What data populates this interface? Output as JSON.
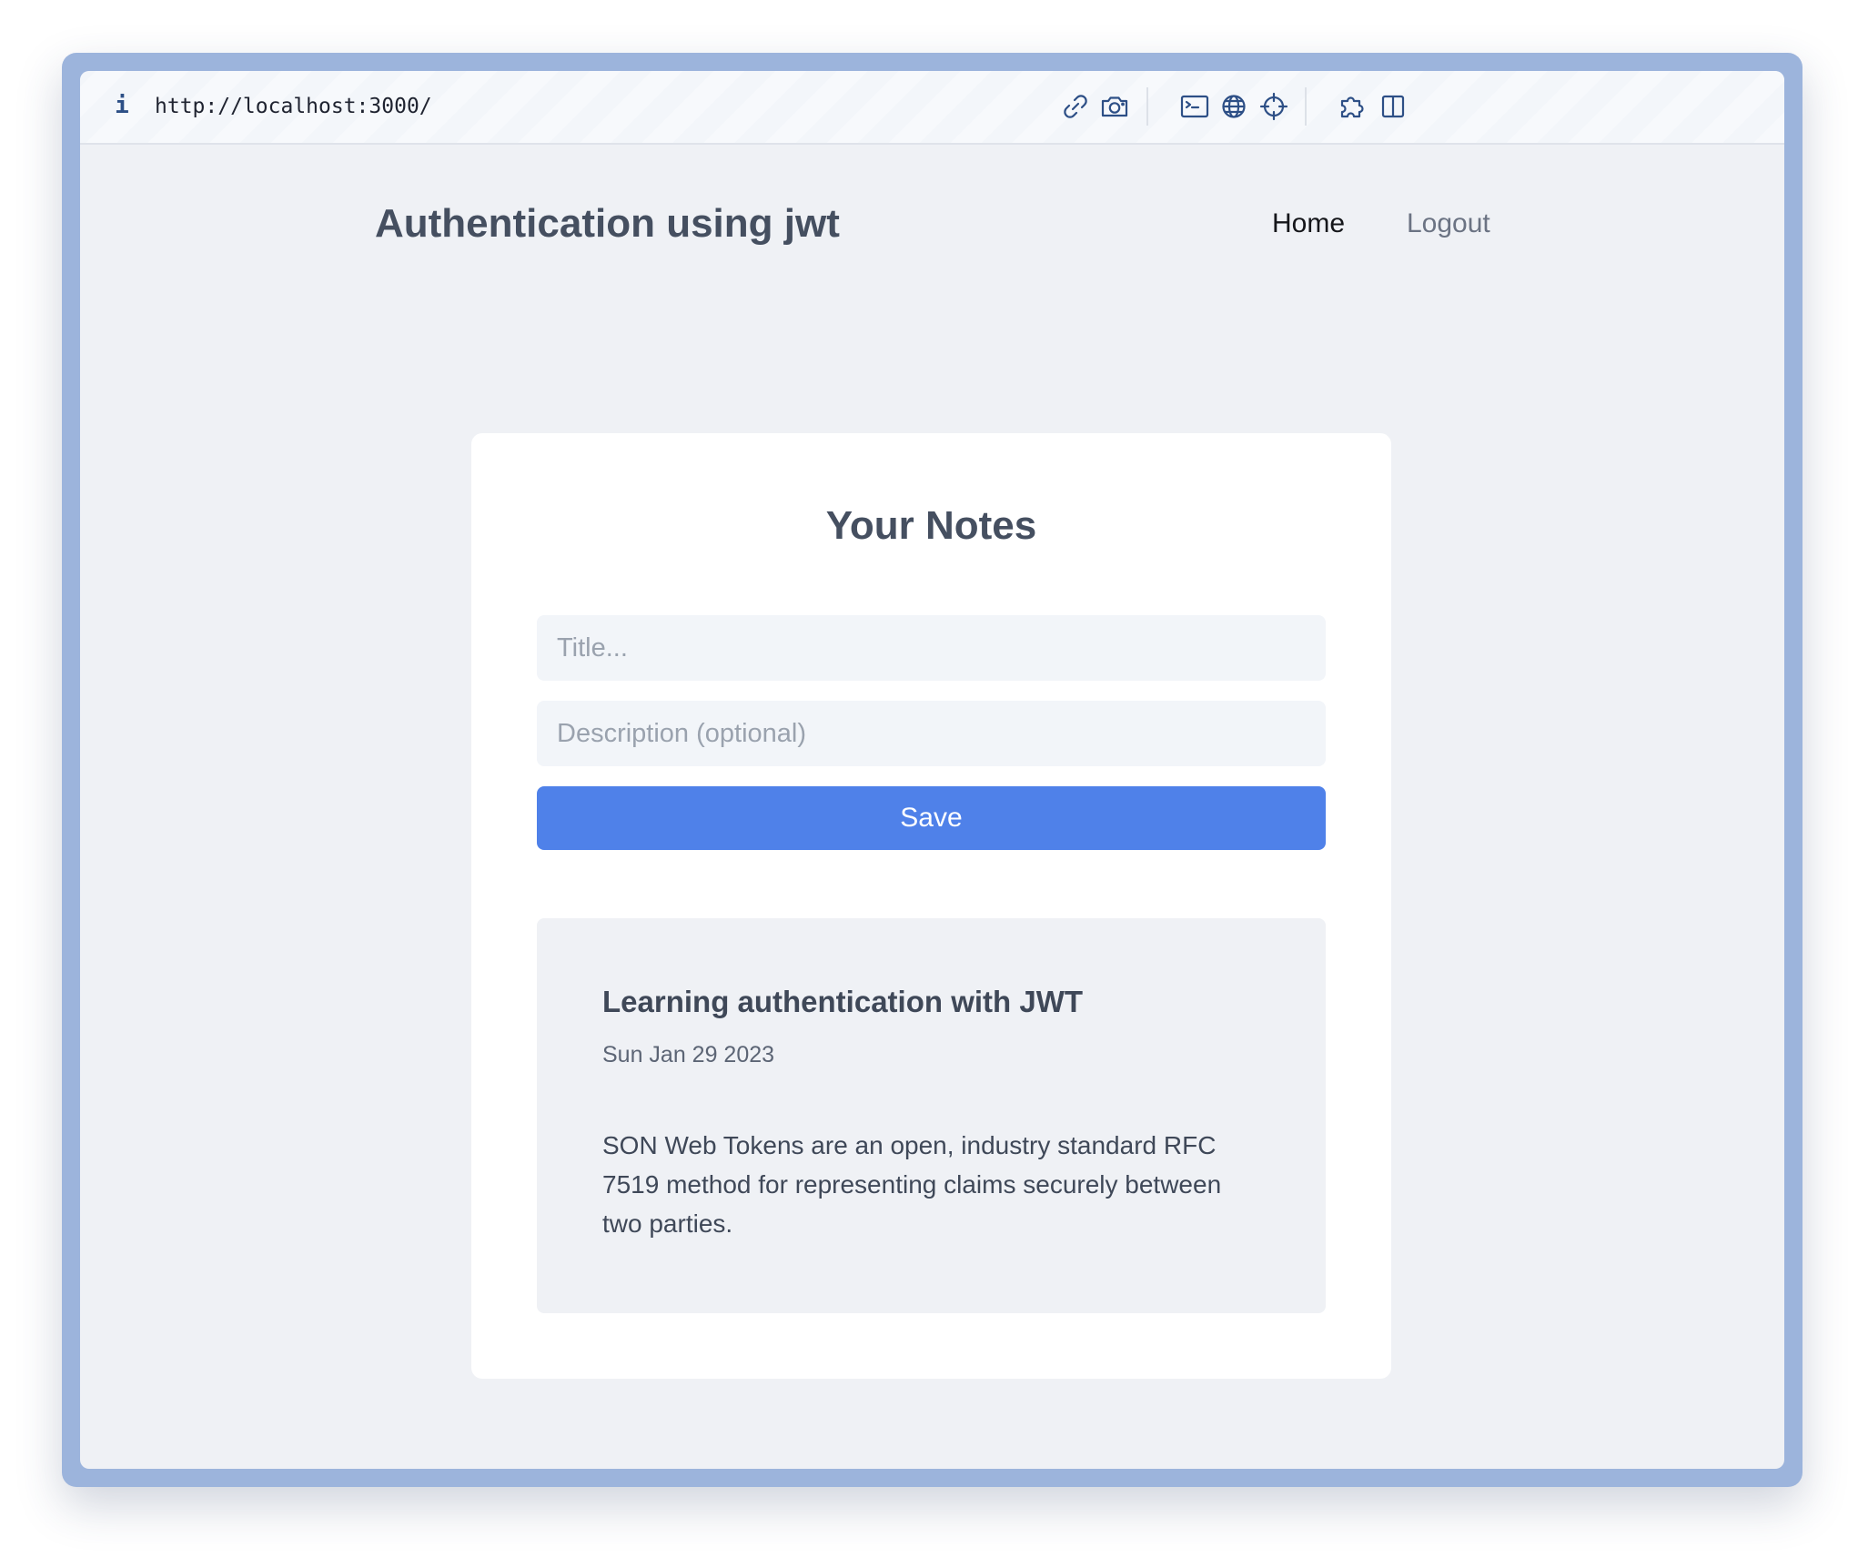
{
  "browser": {
    "info_icon": "i",
    "url": "http://localhost:3000/",
    "toolbar_icons": [
      "link-icon",
      "camera-icon",
      "terminal-icon",
      "globe-icon",
      "crosshair-icon",
      "puzzle-icon",
      "split-view-icon"
    ]
  },
  "header": {
    "title": "Authentication using jwt",
    "nav": {
      "home": "Home",
      "logout": "Logout"
    }
  },
  "notes_card": {
    "heading": "Your Notes",
    "title_placeholder": "Title...",
    "description_placeholder": "Description (optional)",
    "save_label": "Save"
  },
  "notes": [
    {
      "title": "Learning authentication with JWT",
      "date": "Sun Jan 29 2023",
      "body": "SON Web Tokens are an open, industry standard RFC 7519 method for representing claims securely between two parties."
    }
  ],
  "colors": {
    "accent": "#4f81e9",
    "frame": "#9cb4dc",
    "page_background": "#eff1f5",
    "card_background": "#ffffff"
  }
}
